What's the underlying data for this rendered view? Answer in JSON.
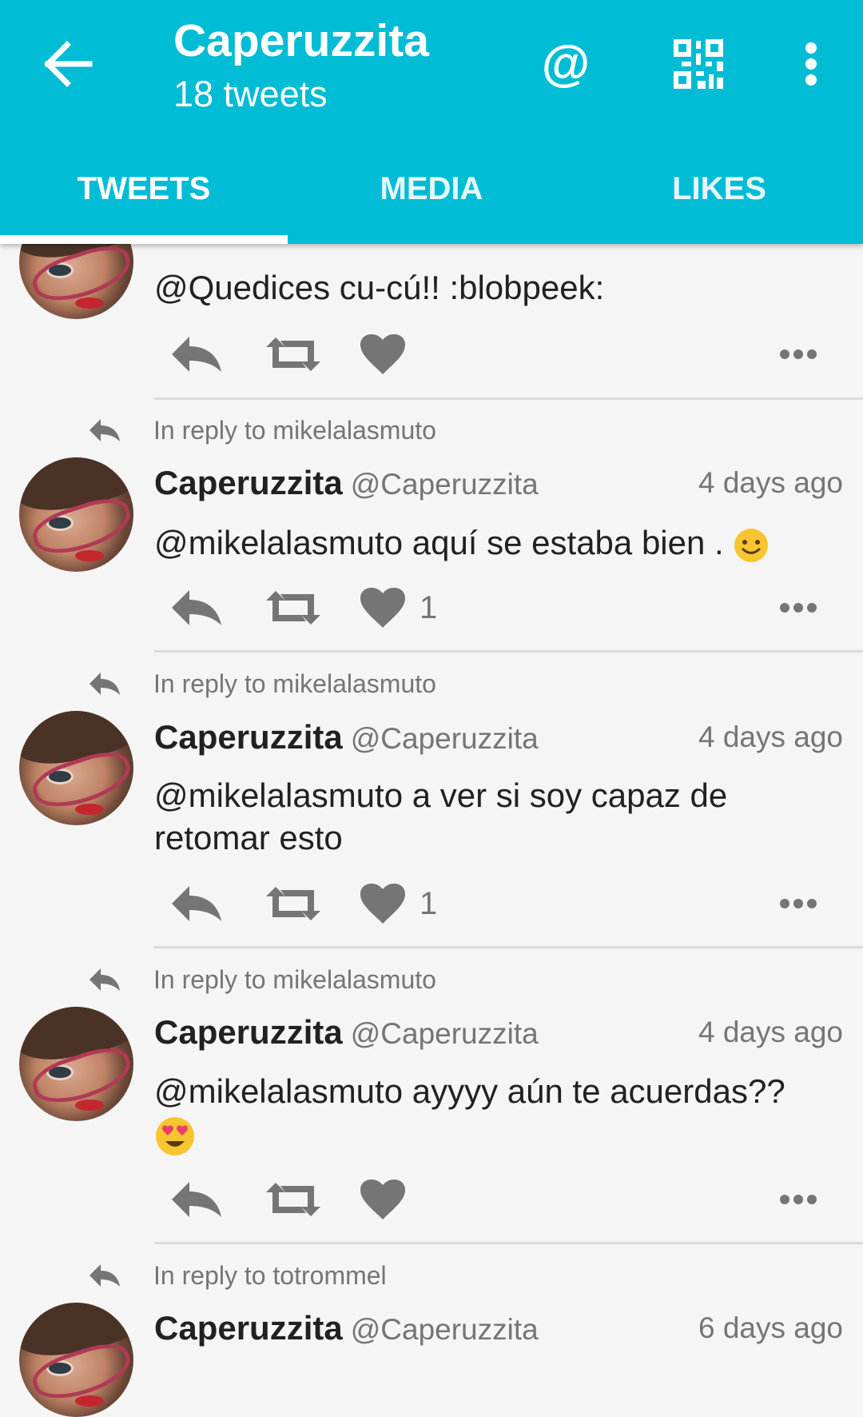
{
  "header": {
    "title": "Caperuzzita",
    "subtitle": "18 tweets",
    "at_symbol": "@",
    "icons": [
      "arrow-back-icon",
      "at-sign-icon",
      "qr-code-icon",
      "more-vert-icon"
    ],
    "accent_color": "#00bcd4"
  },
  "tabs": [
    {
      "label": "TWEETS",
      "active": true
    },
    {
      "label": "MEDIA",
      "active": false
    },
    {
      "label": "LIKES",
      "active": false
    }
  ],
  "tweets": [
    {
      "reply_to": "",
      "name": "",
      "handle": "",
      "time": "",
      "text": "@Quedices cu-cú!! :blobpeek:",
      "likes": "",
      "emoji": ""
    },
    {
      "reply_to": "In reply to mikelalasmuto",
      "name": "Caperuzzita",
      "handle": "@Caperuzzita",
      "time": "4 days ago",
      "text": "@mikelalasmuto aquí se estaba bien . ",
      "likes": "1",
      "emoji": "smiling-face"
    },
    {
      "reply_to": "In reply to mikelalasmuto",
      "name": "Caperuzzita",
      "handle": "@Caperuzzita",
      "time": "4 days ago",
      "text": "@mikelalasmuto a ver si soy capaz de retomar esto",
      "likes": "1",
      "emoji": ""
    },
    {
      "reply_to": "In reply to mikelalasmuto",
      "name": "Caperuzzita",
      "handle": "@Caperuzzita",
      "time": "4 days ago",
      "text": "@mikelalasmuto ayyyy aún te acuerdas??",
      "likes": "",
      "emoji": "heart-eyes-face"
    },
    {
      "reply_to": "In reply to totrommel",
      "name": "Caperuzzita",
      "handle": "@Caperuzzita",
      "time": "6 days ago",
      "text": "",
      "likes": "",
      "emoji": ""
    }
  ],
  "colors": {
    "icon_grey": "#757575",
    "emoji_yellow": "#f7c52f"
  }
}
